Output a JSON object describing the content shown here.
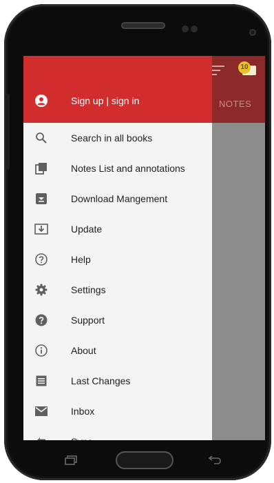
{
  "drawer": {
    "header": {
      "account_label": "Sign up | sign in",
      "account_icon": "account-circle-icon"
    },
    "items": [
      {
        "label": "Search in all books",
        "icon": "search-icon"
      },
      {
        "label": "Notes List and annotations",
        "icon": "notes-library-icon"
      },
      {
        "label": "Download Mangement",
        "icon": "download-box-icon"
      },
      {
        "label": "Update",
        "icon": "update-download-icon"
      },
      {
        "label": "Help",
        "icon": "help-outline-icon"
      },
      {
        "label": "Settings",
        "icon": "gear-icon"
      },
      {
        "label": "Support",
        "icon": "help-filled-icon"
      },
      {
        "label": "About",
        "icon": "info-icon"
      },
      {
        "label": "Last Changes",
        "icon": "list-icon"
      },
      {
        "label": "Inbox",
        "icon": "mail-icon"
      },
      {
        "label": "Sync",
        "icon": "sync-icon"
      }
    ]
  },
  "app_header": {
    "tab_label": "NOTES",
    "notification_count": "10"
  },
  "colors": {
    "drawer_header": "#d22d2d",
    "app_header": "#8b2a28",
    "drawer_bg": "#f4f4f4"
  }
}
